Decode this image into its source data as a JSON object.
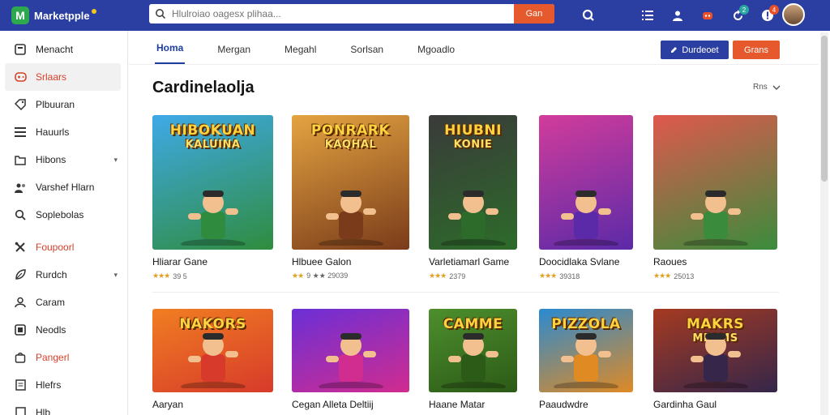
{
  "app": {
    "name": "Marketpple",
    "logo_letter": "M"
  },
  "search": {
    "placeholder": "Hlulroiao oagesx plihaa...",
    "button_label": "Gan"
  },
  "top_icons": [
    {
      "icon": "search-icon"
    },
    {
      "icon": "menu-icon"
    },
    {
      "icon": "user-icon"
    },
    {
      "icon": "gamepad-icon"
    },
    {
      "icon": "refresh-icon",
      "badge": "2"
    },
    {
      "icon": "bell-icon",
      "badge": "4"
    }
  ],
  "sidebar": {
    "items": [
      {
        "label": "Menacht",
        "icon": "home-icon"
      },
      {
        "label": "Srlaars",
        "icon": "gamepad-icon",
        "active": true
      },
      {
        "label": "Plbuuran",
        "icon": "tag-icon"
      },
      {
        "label": "Hauurls",
        "icon": "list-icon"
      },
      {
        "label": "Hibons",
        "icon": "folder-icon",
        "chevron": true
      },
      {
        "label": "Varshef Hlarn",
        "icon": "users-icon"
      },
      {
        "label": "Soplebolas",
        "icon": "search-icon"
      },
      {
        "label": "Foupoorl",
        "icon": "tools-icon",
        "accent": true
      },
      {
        "label": "Rurdch",
        "icon": "leaf-icon",
        "chevron": true
      },
      {
        "label": "Caram",
        "icon": "person-icon"
      },
      {
        "label": "Neodls",
        "icon": "box-icon"
      },
      {
        "label": "Pangerl",
        "icon": "bag-icon",
        "accent": true
      },
      {
        "label": "Hlefrs",
        "icon": "page-icon"
      },
      {
        "label": "Hlb",
        "icon": "doc-icon"
      }
    ]
  },
  "tabs": [
    {
      "label": "Homa",
      "active": true
    },
    {
      "label": "Mergan"
    },
    {
      "label": "Megahl"
    },
    {
      "label": "Sorlsan"
    },
    {
      "label": "Mgoadlo"
    }
  ],
  "actions": {
    "primary_label": "Durdeoet",
    "secondary_label": "Grans"
  },
  "section": {
    "title": "Cardinelaolja",
    "sort_label": "Rns"
  },
  "games_row1": [
    {
      "name": "Hliarar Gane",
      "rating": "39 5",
      "stars": 3,
      "thumb_title": "HIBOKUAN",
      "thumb_sub": "KALUINA",
      "colors": [
        "#3fa9e8",
        "#2f8c3e"
      ]
    },
    {
      "name": "Hlbuee Galon",
      "rating": "9 ★★ 29039",
      "stars": 2,
      "thumb_title": "PONRARK",
      "thumb_sub": "KAQHAL",
      "colors": [
        "#e4a441",
        "#7a3b1a"
      ]
    },
    {
      "name": "Varletiamarl Game",
      "rating": "2379",
      "stars": 3,
      "thumb_title": "HIUBNI",
      "thumb_sub": "KONIE",
      "colors": [
        "#3a3a3a",
        "#2d6b2a"
      ]
    },
    {
      "name": "Doocidlaka Svlane",
      "rating": "39318",
      "stars": 3,
      "thumb_title": "",
      "thumb_sub": "",
      "colors": [
        "#d23c9b",
        "#5b2aa8"
      ]
    },
    {
      "name": "Raoues",
      "rating": "25013",
      "stars": 3,
      "thumb_title": "",
      "thumb_sub": "",
      "colors": [
        "#e0584e",
        "#3a8c3c"
      ]
    }
  ],
  "games_row2": [
    {
      "name": "Aaryan",
      "thumb_title": "NAKORS",
      "thumb_sub": "",
      "colors": [
        "#f07e22",
        "#d73a2a"
      ]
    },
    {
      "name": "Cegan Alleta Deltiij",
      "thumb_title": "",
      "thumb_sub": "",
      "colors": [
        "#6b2fd6",
        "#d12c8f"
      ]
    },
    {
      "name": "Haane Matar",
      "thumb_title": "CAMME",
      "thumb_sub": "",
      "colors": [
        "#4d8f2d",
        "#2c5a17"
      ]
    },
    {
      "name": "Paaudwdre",
      "thumb_title": "PIZZOLA",
      "thumb_sub": "",
      "colors": [
        "#2a8ad1",
        "#e08a24"
      ]
    },
    {
      "name": "Gardinha Gaul",
      "thumb_title": "MAKRS",
      "thumb_sub": "MECMS",
      "colors": [
        "#a53a21",
        "#35264a"
      ]
    }
  ]
}
